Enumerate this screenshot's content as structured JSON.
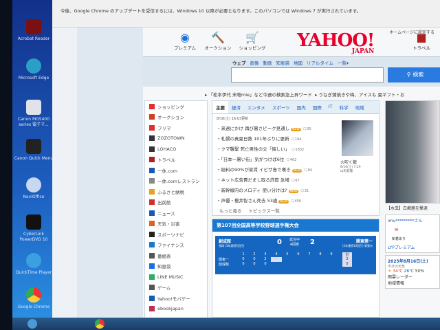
{
  "desktop": {
    "icons": [
      "Acrobat Reader",
      "Microsoft Edge",
      "Canon MG5400 series 電子マ...",
      "Canon Quick Menu",
      "NaviOffice",
      "CyberLink PowerDVD 10",
      "QuickTime Player",
      "Google Chrome"
    ]
  },
  "infobar": {
    "text": "今後、Google Chrome のアップデートを受信するには、Windows 10 以降が必要となります。このパソコンでは Windows 7 が実行されています。"
  },
  "header": {
    "set_home": "ホームページに設定する",
    "services": [
      "プレミアム",
      "オークション",
      "ショッピング",
      "トラベル"
    ],
    "logo": "YAHOO!",
    "logo_sub": "JAPAN"
  },
  "search": {
    "tabs": [
      "ウェブ",
      "画像",
      "動画",
      "知恵袋",
      "地図",
      "リアルタイム",
      "一覧▾"
    ],
    "value": "",
    "button": "検索"
  },
  "trend": {
    "text": "「松本伊代 末唯mie」など今週の検索急上昇ワード",
    "text2": "うなぎ蒲焼きや梅、アイスも 夏ギフト・お"
  },
  "left_nav": [
    "ショッピング",
    "オークション",
    "フリマ",
    "ZOZOTOWN",
    "LOHACO",
    "トラベル",
    "一休.com",
    "一休.comレストラン",
    "ふるさと納税",
    "出前館",
    "ニュース",
    "天気・災害",
    "スポーツナビ",
    "ファイナンス",
    "番組表",
    "知恵袋",
    "LINE MUSIC",
    "ゲーム",
    "Yahoo!モバゲー",
    "ebookjapan"
  ],
  "news": {
    "tabs": [
      "主要",
      "経済",
      "エンタメ",
      "スポーツ",
      "国内",
      "国際",
      "IT",
      "科学",
      "地域"
    ],
    "updated": "8/16(土) 16:03更新",
    "items": [
      {
        "title": "来週にかけ 再び暑さピーク見通し",
        "new": true,
        "comments": "35"
      },
      {
        "title": "札幌の真夏日数 101年ぶりに更新",
        "new": false,
        "comments": "194"
      },
      {
        "title": "クマ襲撃 死亡男性の父「悔しい」",
        "new": false,
        "comments": "1832"
      },
      {
        "title": "「日本一暑い街」気がつけば6位",
        "new": false,
        "comments": "462"
      },
      {
        "title": "給料の90%が家賃 イビザ島で嘆き",
        "new": true,
        "comments": "84"
      },
      {
        "title": "ネット広告費だまし取る詐欺 急増",
        "new": false,
        "comments": "67"
      },
      {
        "title": "新幹線内のメロディ 使い分けは?",
        "new": true,
        "comments": "31"
      },
      {
        "title": "声優・櫻井智さん死去 53歳",
        "new": true,
        "comments": "456"
      }
    ],
    "new_label": "NEW",
    "more": "もっと見る",
    "topics": "トピックス一覧",
    "photo_caption": "火吹く龍",
    "photo_date": "8/16(土) 7:29",
    "photo_source": "山形新聞"
  },
  "baseball": {
    "title": "第107回全国高等学校野球選手権大会",
    "home": "創成館",
    "home_sub": "長崎 (3年連続5回目)",
    "home_score": "0",
    "status": "試合中",
    "inning": "4回表",
    "away_score": "2",
    "away": "関東第一",
    "away_sub": "(2年連続10回目) 東東京",
    "innings": [
      "1",
      "2",
      "3",
      "4",
      "5",
      "6",
      "7",
      "8",
      "9"
    ],
    "total_label": "計",
    "rows": [
      {
        "team": "関東一",
        "scores": [
          "0",
          "0",
          "2",
          "-"
        ],
        "total": "2"
      },
      {
        "team": "創成館",
        "scores": [
          "0",
          "0",
          "0"
        ],
        "total": "0"
      }
    ]
  },
  "right": {
    "photo_caption": "【水虫】白癬菌を撃退",
    "user": "imu*********さん",
    "mail": "新着あり",
    "premium": "LYPプレミアム",
    "date": "2025年8月16日(土)",
    "weather_label": "今日の天気",
    "high": "34℃",
    "low": "26℃",
    "rain": "50%",
    "radar": "雨雲レーダー",
    "local": "地域情報"
  }
}
